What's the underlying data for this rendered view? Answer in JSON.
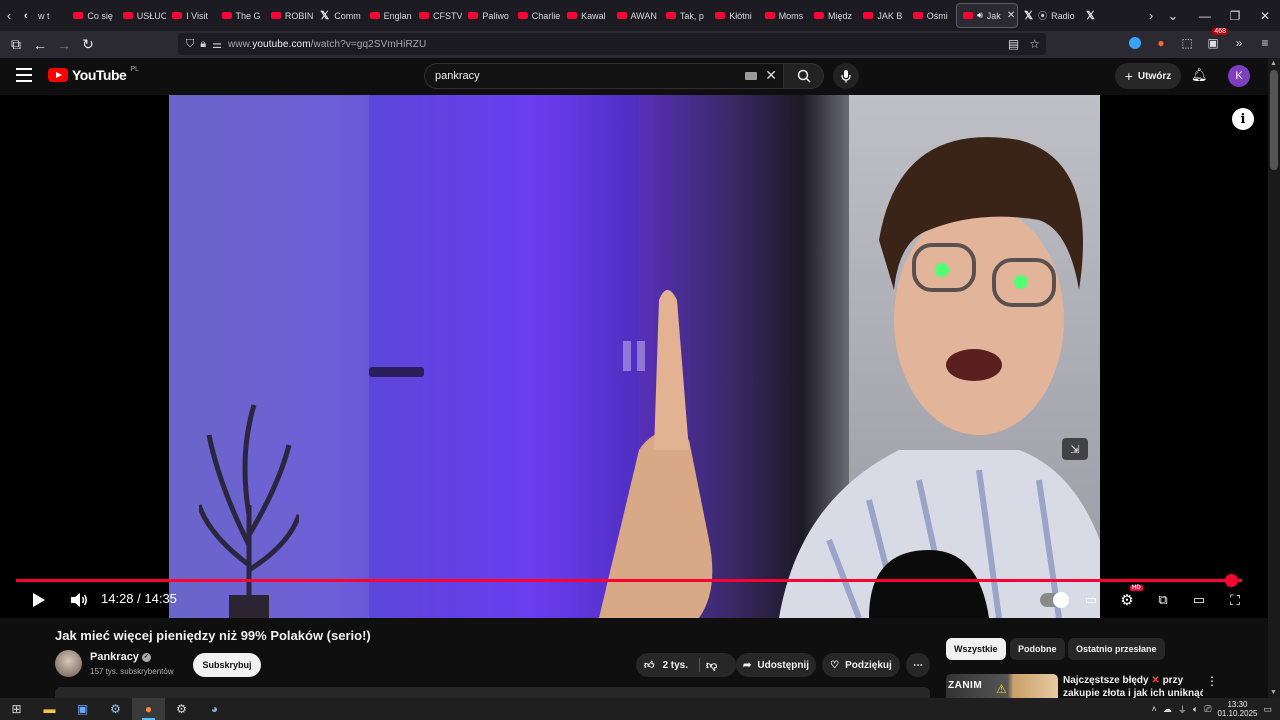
{
  "browser": {
    "tabs": [
      {
        "label": "w t",
        "icon": "back-arrow"
      },
      {
        "label": "Co się",
        "icon": "youtube"
      },
      {
        "label": "USŁUC",
        "icon": "youtube"
      },
      {
        "label": "I Visit",
        "icon": "youtube"
      },
      {
        "label": "The G",
        "icon": "youtube"
      },
      {
        "label": "ROBIN",
        "icon": "youtube"
      },
      {
        "label": "Comm",
        "icon": "x"
      },
      {
        "label": "Englan",
        "icon": "youtube"
      },
      {
        "label": "CFSTV",
        "icon": "youtube"
      },
      {
        "label": "Paliwo",
        "icon": "youtube"
      },
      {
        "label": "Charlie",
        "icon": "youtube"
      },
      {
        "label": "Kawal",
        "icon": "youtube"
      },
      {
        "label": "AWAN",
        "icon": "youtube"
      },
      {
        "label": "Tak, p",
        "icon": "youtube"
      },
      {
        "label": "Kłótni",
        "icon": "youtube"
      },
      {
        "label": "Moms",
        "icon": "youtube"
      },
      {
        "label": "Międz",
        "icon": "youtube"
      },
      {
        "label": "JAK B",
        "icon": "youtube"
      },
      {
        "label": "Ośmi",
        "icon": "youtube"
      }
    ],
    "active_tab": {
      "label": "Jak",
      "icon": "youtube"
    },
    "after_tabs": [
      {
        "label": "Radio",
        "icon": "x"
      },
      {
        "label": "",
        "icon": "x"
      }
    ],
    "url_prefix": "www.",
    "url_domain": "youtube.com",
    "url_rest": "/watch?v=gq2SVmHiRZU",
    "extension_badge": "468"
  },
  "youtube": {
    "logo_text": "YouTube",
    "logo_region": "PL",
    "search_query": "pankracy",
    "create_label": "Utwórz",
    "avatar_letter": "K"
  },
  "player": {
    "current_time": "14:28",
    "duration": "14:35",
    "time_display": "14:28 / 14:35",
    "progress_fraction": 0.992,
    "quality_badge": "HD",
    "accent_color": "#ff0033"
  },
  "video": {
    "title": "Jak mieć więcej pieniędzy niż 99% Polaków (serio!)",
    "channel_name": "Pankracy",
    "subscribers": "157 tys. subskrybentów",
    "subscribe_label": "Subskrybuj",
    "likes": "2 tys.",
    "share_label": "Udostępnij",
    "thanks_label": "Podziękuj"
  },
  "recommendations": {
    "chips": [
      "Wszystkie",
      "Podobne",
      "Ostatnio przesłane"
    ],
    "first_thumb_text": "ZANIM",
    "first_title_a": "Najczęstsze błędy",
    "first_title_b": "przy",
    "first_title_line2": "zakupie złota i jak ich uniknąć"
  },
  "taskbar": {
    "time": "13:30",
    "date": "01.10.2025"
  }
}
